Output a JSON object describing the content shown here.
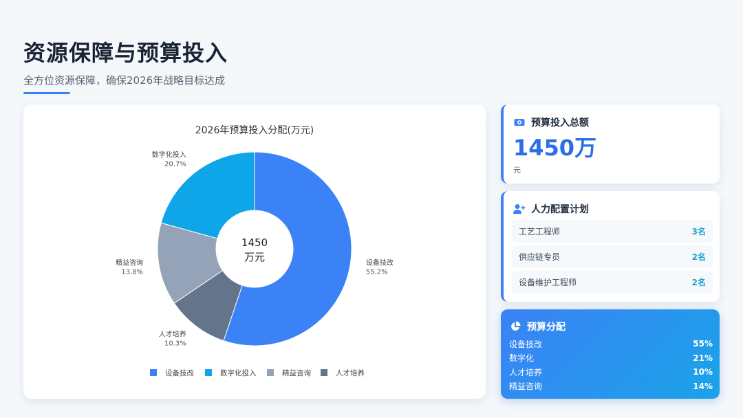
{
  "header": {
    "title": "资源保障与预算投入",
    "subtitle": "全方位资源保障，确保2026年战略目标达成"
  },
  "chart_data": {
    "type": "pie",
    "variant": "donut",
    "title": "2026年预算投入分配(万元)",
    "center_label": [
      "1450",
      "万元"
    ],
    "categories": [
      "设备技改",
      "数字化投入",
      "精益咨询",
      "人才培养"
    ],
    "values": [
      800,
      300,
      200,
      150
    ],
    "percent_labels": [
      "55.2%",
      "20.7%",
      "13.8%",
      "10.3%"
    ],
    "colors": [
      "#3b82f6",
      "#0ea5e9",
      "#94a3b8",
      "#64748b"
    ],
    "legend": "bottom"
  },
  "budget": {
    "icon": "money-icon",
    "title": "预算投入总额",
    "value": "1450万",
    "unit": "元"
  },
  "staff": {
    "icon": "user-plus-icon",
    "title": "人力配置计划",
    "rows": [
      {
        "role": "工艺工程师",
        "count": "3名"
      },
      {
        "role": "供应链专员",
        "count": "2名"
      },
      {
        "role": "设备维护工程师",
        "count": "2名"
      }
    ]
  },
  "allocation": {
    "icon": "pie-chart-icon",
    "title": "预算分配",
    "rows": [
      {
        "label": "设备技改",
        "pct": "55%"
      },
      {
        "label": "数字化",
        "pct": "21%"
      },
      {
        "label": "人才培养",
        "pct": "10%"
      },
      {
        "label": "精益咨询",
        "pct": "14%"
      }
    ]
  },
  "colors": {
    "accent": "#3b82f6",
    "accent_dark": "#2b6ee6",
    "count_teal": "#1aa5c9"
  }
}
